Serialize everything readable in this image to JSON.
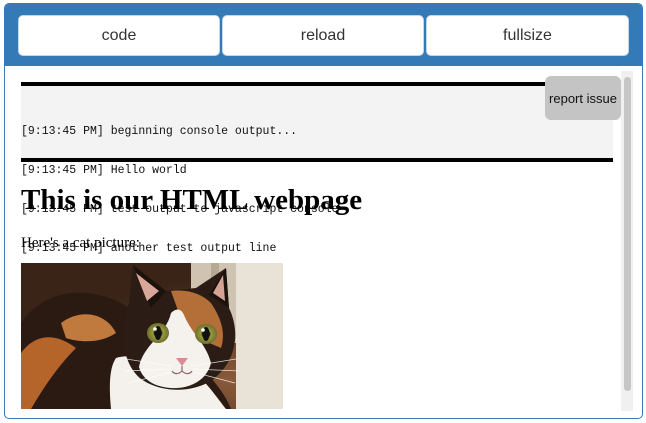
{
  "toolbar": {
    "code_label": "code",
    "reload_label": "reload",
    "fullsize_label": "fullsize"
  },
  "console": {
    "lines": [
      "[9:13:45 PM] beginning console output...",
      "[9:13:45 PM] Hello world",
      "[9:13:45 PM] test output to javascript console",
      "[9:13:45 PM] another test output line"
    ],
    "report_label": "report issue"
  },
  "page": {
    "title": "This is our HTML webpage",
    "text": "Here's a cat picture:",
    "image_icon": "cat-photo"
  },
  "colors": {
    "toolbar_bg": "#337ab7",
    "console_bg": "#f3f3f3",
    "report_bg": "#c4c4c4"
  }
}
